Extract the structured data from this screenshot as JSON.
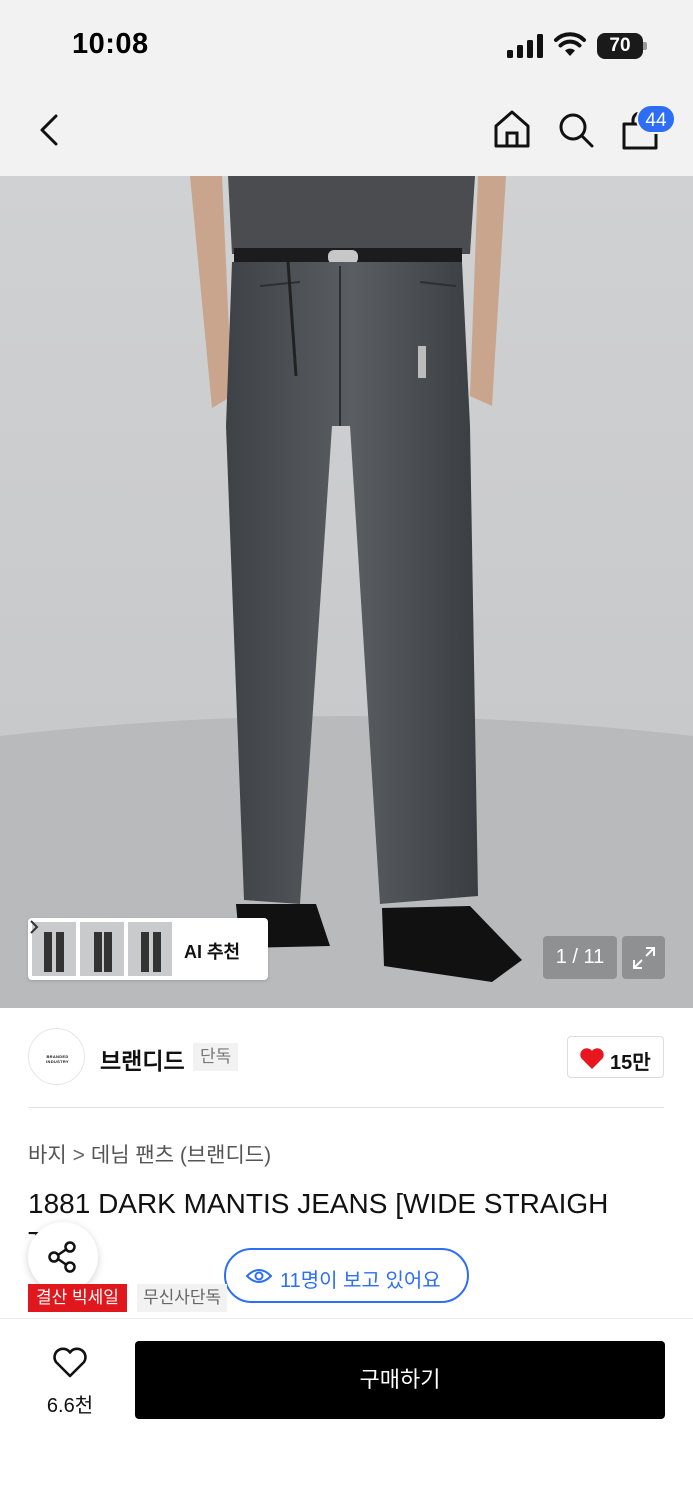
{
  "status_bar": {
    "time": "10:08",
    "battery": "70"
  },
  "nav": {
    "cart_count": "44"
  },
  "gallery": {
    "counter": "1 / 11",
    "ai_label": "AI 추천"
  },
  "brand": {
    "name": "브랜디드",
    "logo_text": "BRANDED INDUSTRY",
    "tag": "단독",
    "likes": "15만"
  },
  "breadcrumb": {
    "category": "바지",
    "separator": ">",
    "subcategory": "데님 팬츠 (브랜디드)"
  },
  "product": {
    "title": "1881 DARK MANTIS JEANS [WIDE STRAIGH",
    "title_overflow": "T",
    "viewers": "11명이 보고 있어요",
    "tags": [
      "결산 빅세일",
      "무신사단독"
    ]
  },
  "bottom_bar": {
    "wish_count": "6.6천",
    "buy_label": "구매하기"
  },
  "colors": {
    "accent_blue": "#2d6ef5",
    "sale_red": "#e0171c",
    "heart_red": "#e8161e",
    "buy_black": "#000000"
  }
}
